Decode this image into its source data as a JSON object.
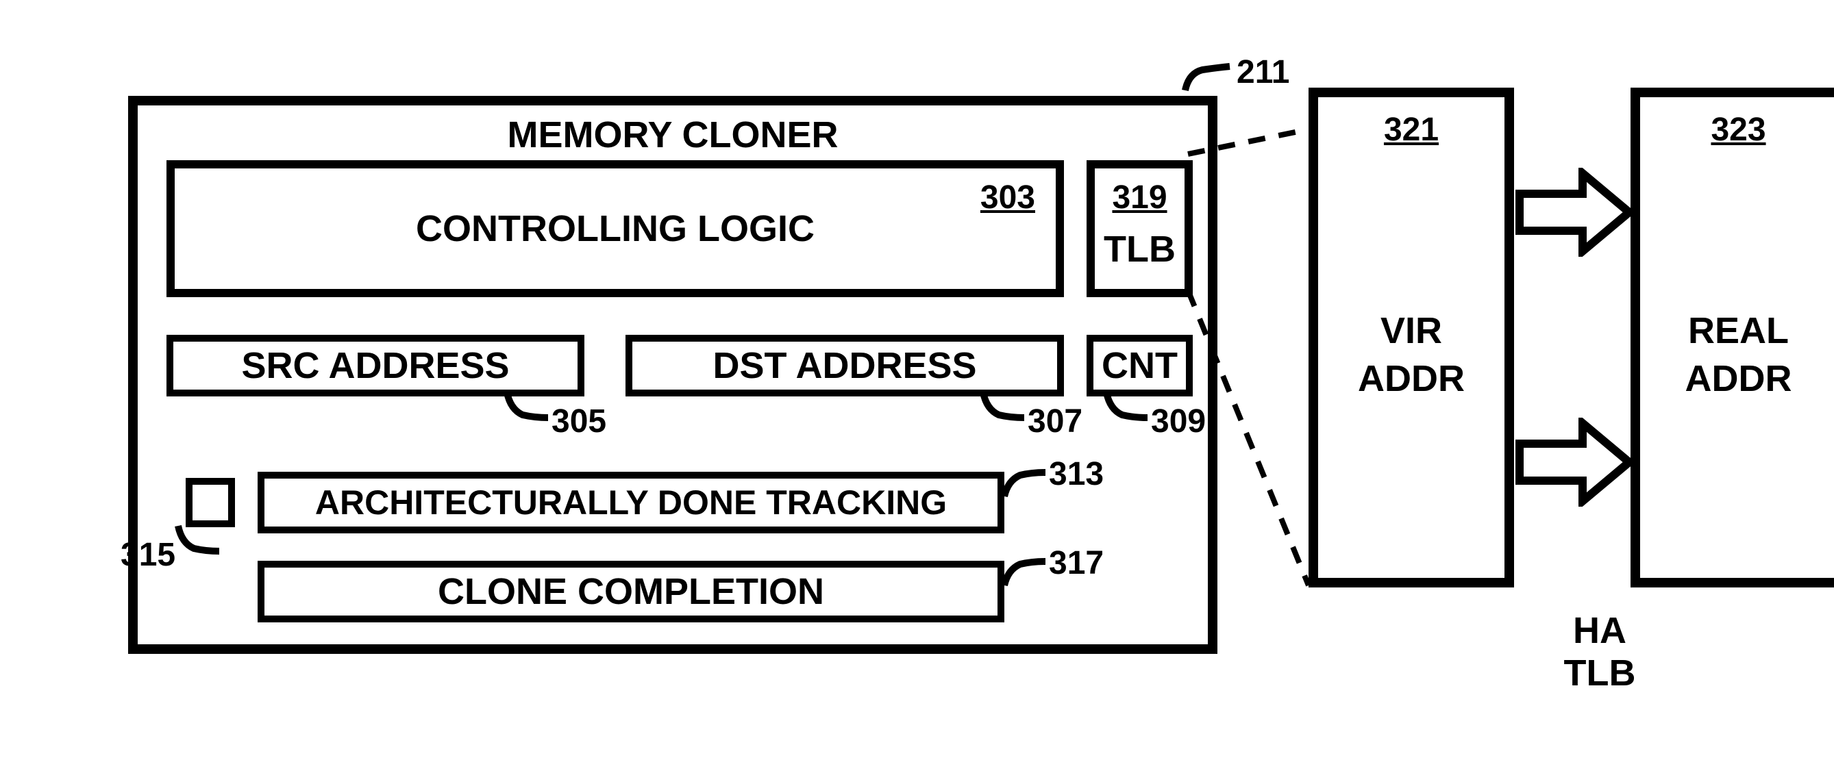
{
  "memory_cloner": {
    "title": "MEMORY CLONER",
    "callout_num": "211",
    "controlling_logic": {
      "label": "CONTROLLING LOGIC",
      "num": "303"
    },
    "tlb": {
      "label": "TLB",
      "num": "319"
    },
    "src_address": {
      "label": "SRC ADDRESS",
      "num": "305"
    },
    "dst_address": {
      "label": "DST ADDRESS",
      "num": "307"
    },
    "cnt": {
      "label": "CNT",
      "num": "309"
    },
    "arch_tracking": {
      "label": "ARCHITECTURALLY DONE TRACKING",
      "num": "313"
    },
    "small_register": {
      "num": "315"
    },
    "clone_completion": {
      "label": "CLONE COMPLETION",
      "num": "317"
    }
  },
  "tlb_detail": {
    "vir_addr": {
      "line1": "VIR",
      "line2": "ADDR",
      "num": "321"
    },
    "real_addr": {
      "line1": "REAL",
      "line2": "ADDR",
      "num": "323"
    },
    "bottom_label_line1": "HA",
    "bottom_label_line2": "TLB"
  }
}
